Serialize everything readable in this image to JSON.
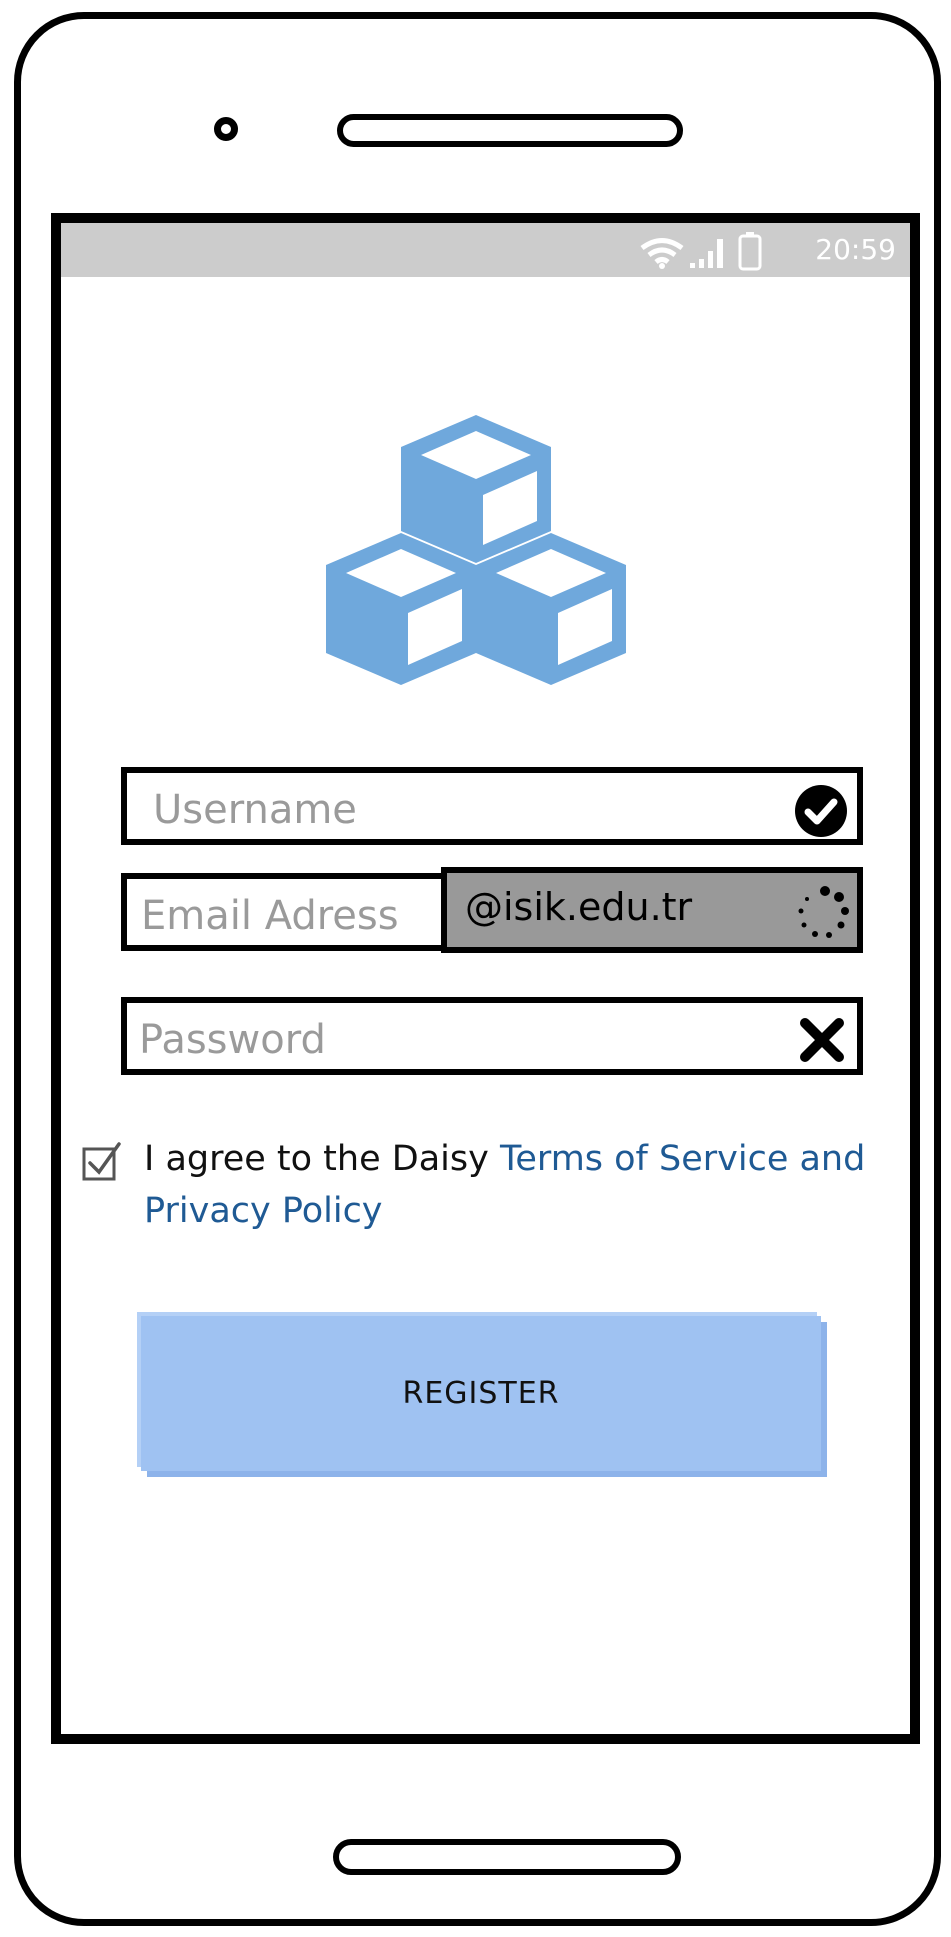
{
  "status_bar": {
    "time": "20:59",
    "icons": [
      "wifi-icon",
      "signal-icon",
      "battery-icon"
    ]
  },
  "logo": {
    "icon": "cubes-logo-icon",
    "color": "#6fa8dc"
  },
  "form": {
    "username_placeholder": "Username",
    "username_status_icon": "check-circle-icon",
    "email_placeholder": "Email Adress",
    "email_domain": "@isik.edu.tr",
    "email_status_icon": "loading-spinner-icon",
    "password_placeholder": "Password",
    "password_status_icon": "x-icon"
  },
  "agreement": {
    "checked": true,
    "text_prefix": "I agree to the Daisy ",
    "link_text": "Terms of Service and Privacy Policy"
  },
  "register_button": {
    "label": "REGISTER",
    "color": "#9fc2f2"
  }
}
